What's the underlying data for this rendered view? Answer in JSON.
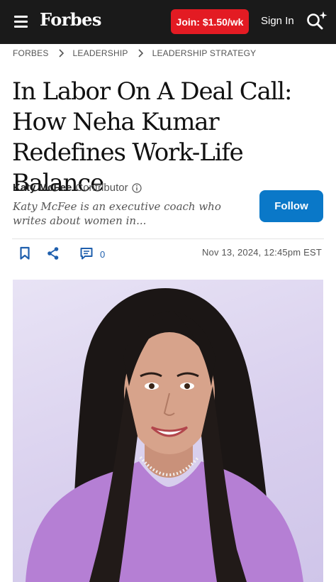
{
  "header": {
    "logo": "Forbes",
    "join_label": "Join: $1.50/wk",
    "signin_label": "Sign In"
  },
  "breadcrumb": {
    "items": [
      "FORBES",
      "LEADERSHIP",
      "LEADERSHIP STRATEGY"
    ]
  },
  "article": {
    "title": "In Labor On A Deal Call: How Neha Kumar Redefines Work-Life Balance",
    "author": {
      "name": "Katy McFee",
      "role": "Contributor",
      "bio": "Katy McFee is an executive coach who writes about women in..."
    },
    "follow_label": "Follow",
    "comment_count": "0",
    "date": "Nov 13, 2024, 12:45pm EST"
  },
  "colors": {
    "topbar": "#1a1a1a",
    "join_button": "#e31b23",
    "follow_button": "#0a78c8",
    "action_icons": "#1f5fad",
    "photo_background": "#d9d0ee"
  },
  "icons": [
    "menu-icon",
    "search-sparkle-icon",
    "chevron-right-icon",
    "info-icon",
    "bookmark-icon",
    "share-icon",
    "comment-icon"
  ]
}
